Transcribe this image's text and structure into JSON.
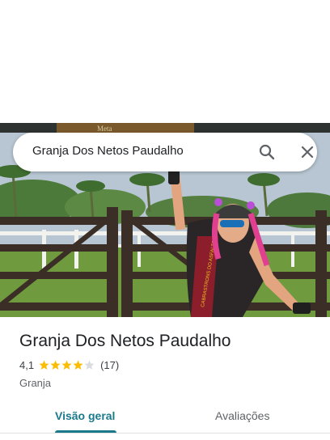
{
  "search": {
    "query": "Granja Dos Netos Paudalho"
  },
  "place": {
    "name": "Granja Dos Netos Paudalho",
    "rating": "4,1",
    "rating_value": 4.1,
    "review_count": "(17)",
    "category": "Granja"
  },
  "tabs": [
    {
      "label": "Visão geral",
      "active": true
    },
    {
      "label": "Avaliações",
      "active": false
    }
  ],
  "photo": {
    "jersey_text": "CABRASTRONS DO ASFALTO",
    "banner_text": "Meta"
  },
  "colors": {
    "accent": "#1a7a8b",
    "star": "#fbbc04",
    "star_empty": "#dadce0"
  }
}
